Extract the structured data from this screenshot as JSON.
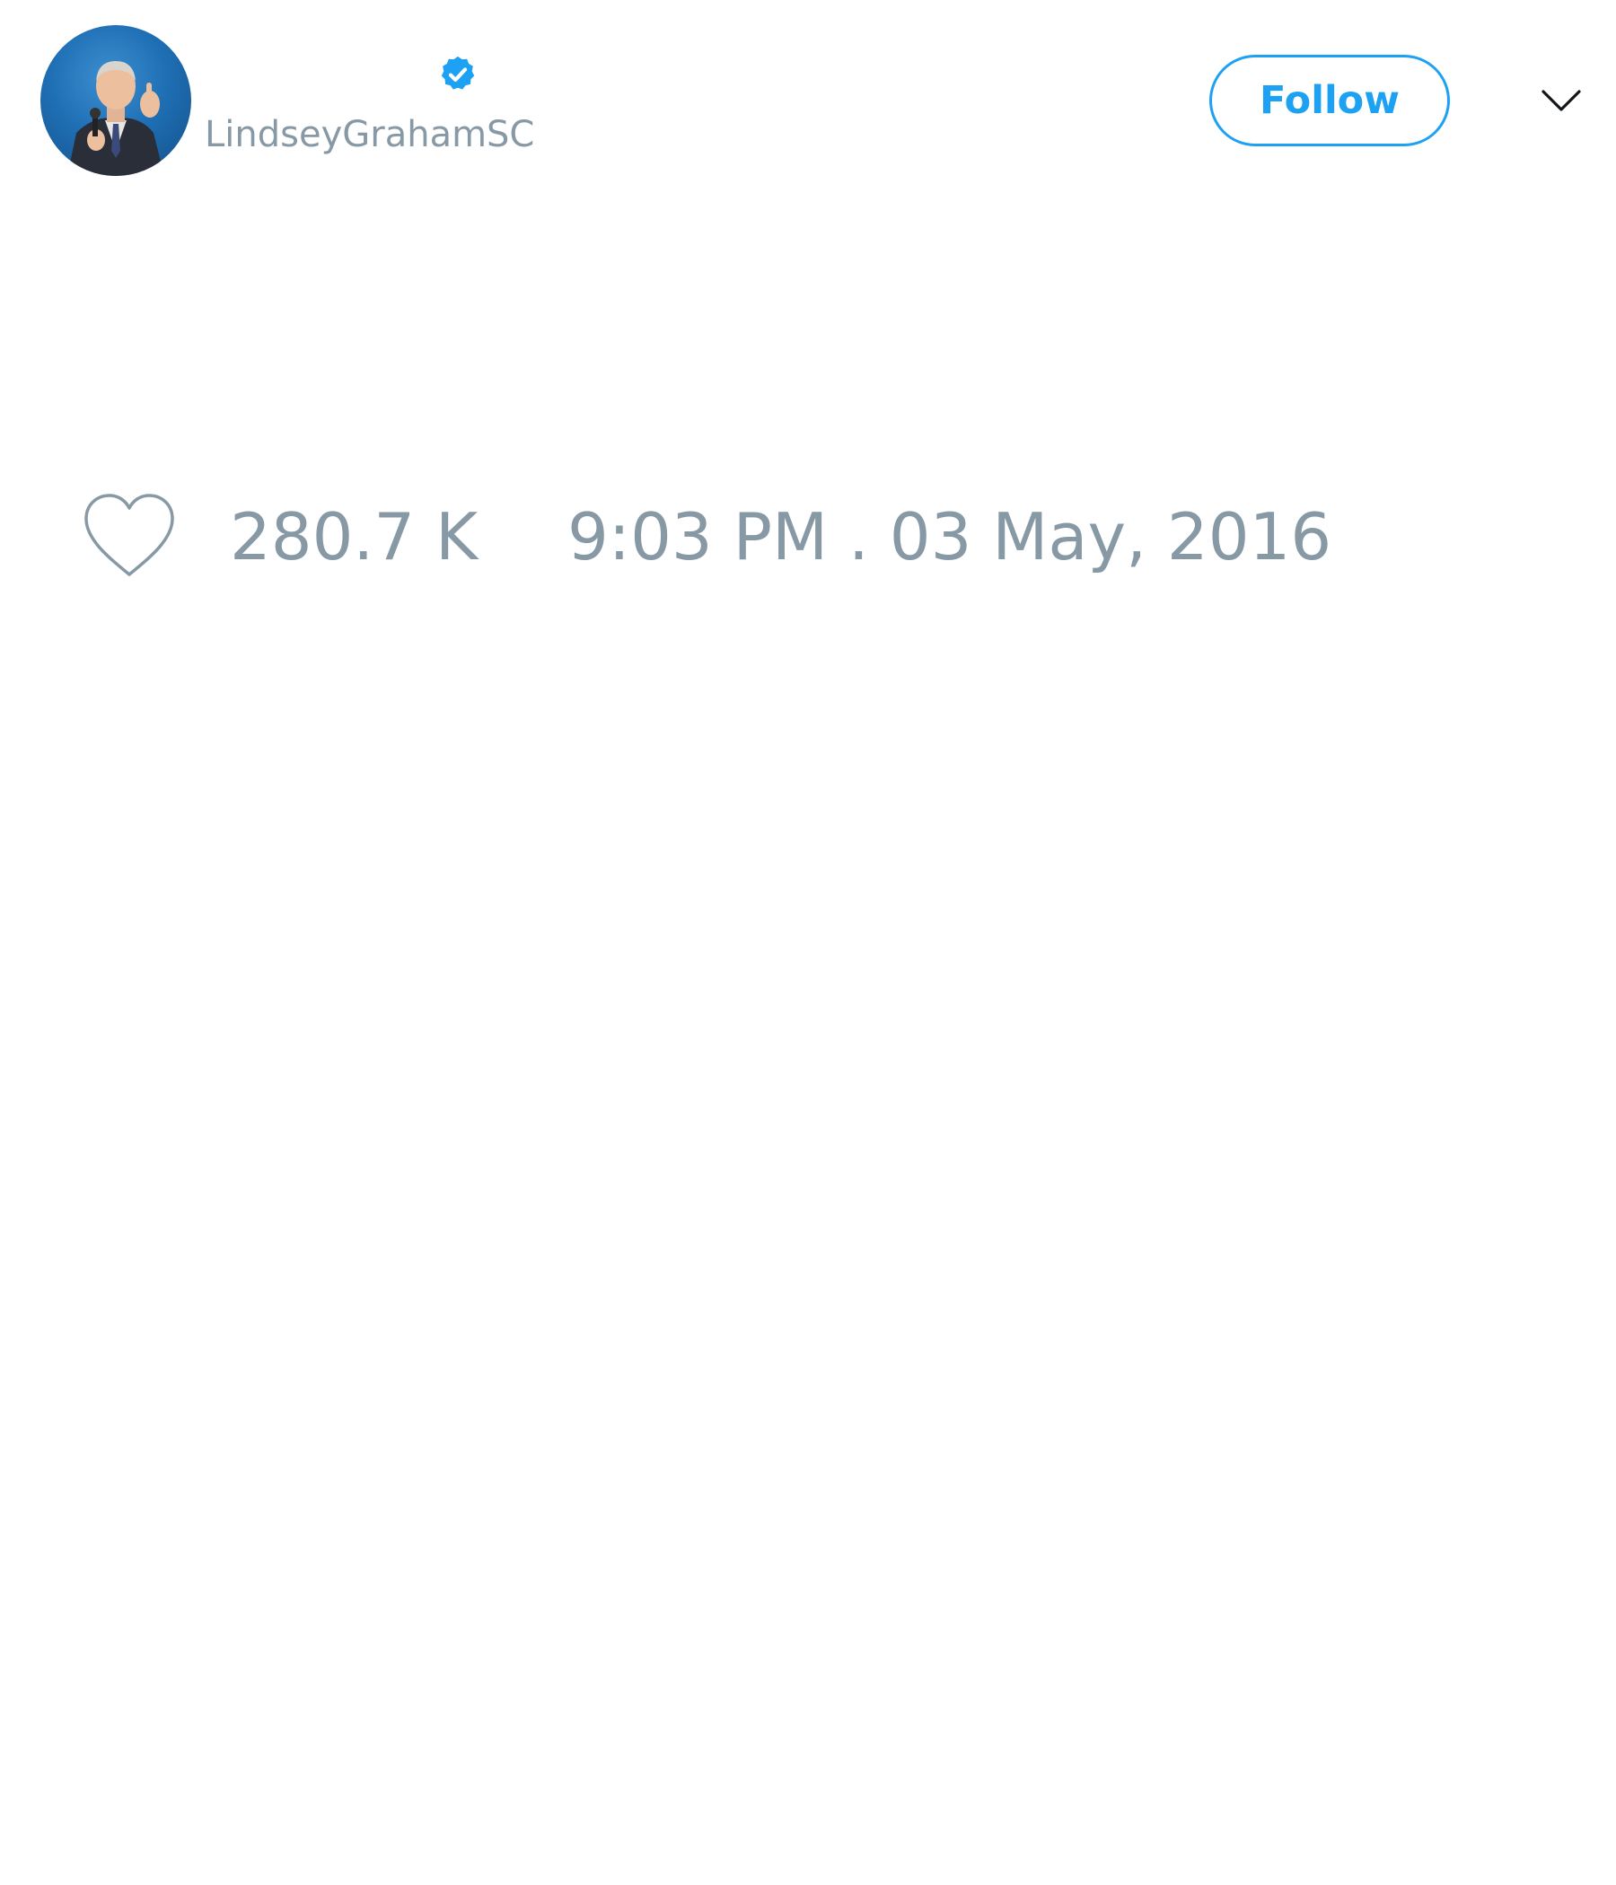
{
  "tweet": {
    "author": {
      "handle": "LindseyGrahamSC",
      "verified": true,
      "avatar": "profile-photo"
    },
    "follow_button": {
      "label": "Follow",
      "color": "#1da1f2"
    },
    "menu_icon": "chevron-down-icon",
    "likes": {
      "icon": "heart-icon",
      "count": "280.7 K"
    },
    "timestamp": "9:03 PM . 03 May, 2016",
    "colors": {
      "muted_text": "#8899a6",
      "accent": "#1da1f2"
    }
  }
}
